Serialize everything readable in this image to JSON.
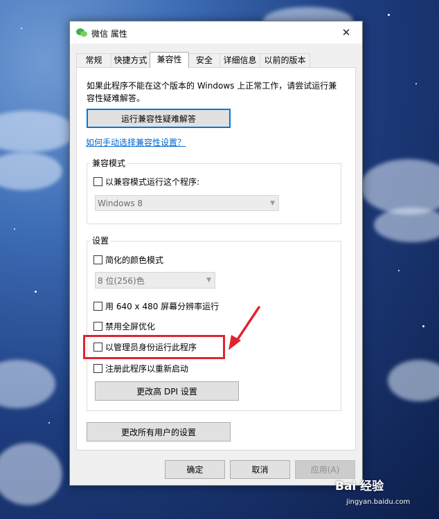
{
  "window": {
    "title": "微信 属性",
    "close_glyph": "✕"
  },
  "tabs": [
    {
      "label": "常规"
    },
    {
      "label": "快捷方式"
    },
    {
      "label": "兼容性",
      "active": true
    },
    {
      "label": "安全"
    },
    {
      "label": "详细信息"
    },
    {
      "label": "以前的版本"
    }
  ],
  "intro_text": "如果此程序不能在这个版本的 Windows 上正常工作，请尝试运行兼容性疑难解答。",
  "troubleshooter_button": "运行兼容性疑难解答",
  "manual_link": "如何手动选择兼容性设置？",
  "compat_mode": {
    "group_label": "兼容模式",
    "checkbox_label": "以兼容模式运行这个程序:",
    "select_value": "Windows 8"
  },
  "settings": {
    "group_label": "设置",
    "reduced_color_label": "简化的颜色模式",
    "color_select_value": "8 位(256)色",
    "resolution_label": "用 640 x 480 屏幕分辨率运行",
    "fullscreen_opt_label": "禁用全屏优化",
    "run_as_admin_label": "以管理员身份运行此程序",
    "register_restart_label": "注册此程序以重新启动",
    "dpi_button": "更改高 DPI 设置"
  },
  "all_users_button": "更改所有用户的设置",
  "footer": {
    "ok": "确定",
    "cancel": "取消",
    "apply": "应用(A)"
  },
  "watermark": {
    "main": "Bai 经验",
    "sub": "jingyan.baidu.com"
  },
  "colors": {
    "accent": "#0078d7",
    "highlight": "#e0242f",
    "link": "#0066cc"
  }
}
